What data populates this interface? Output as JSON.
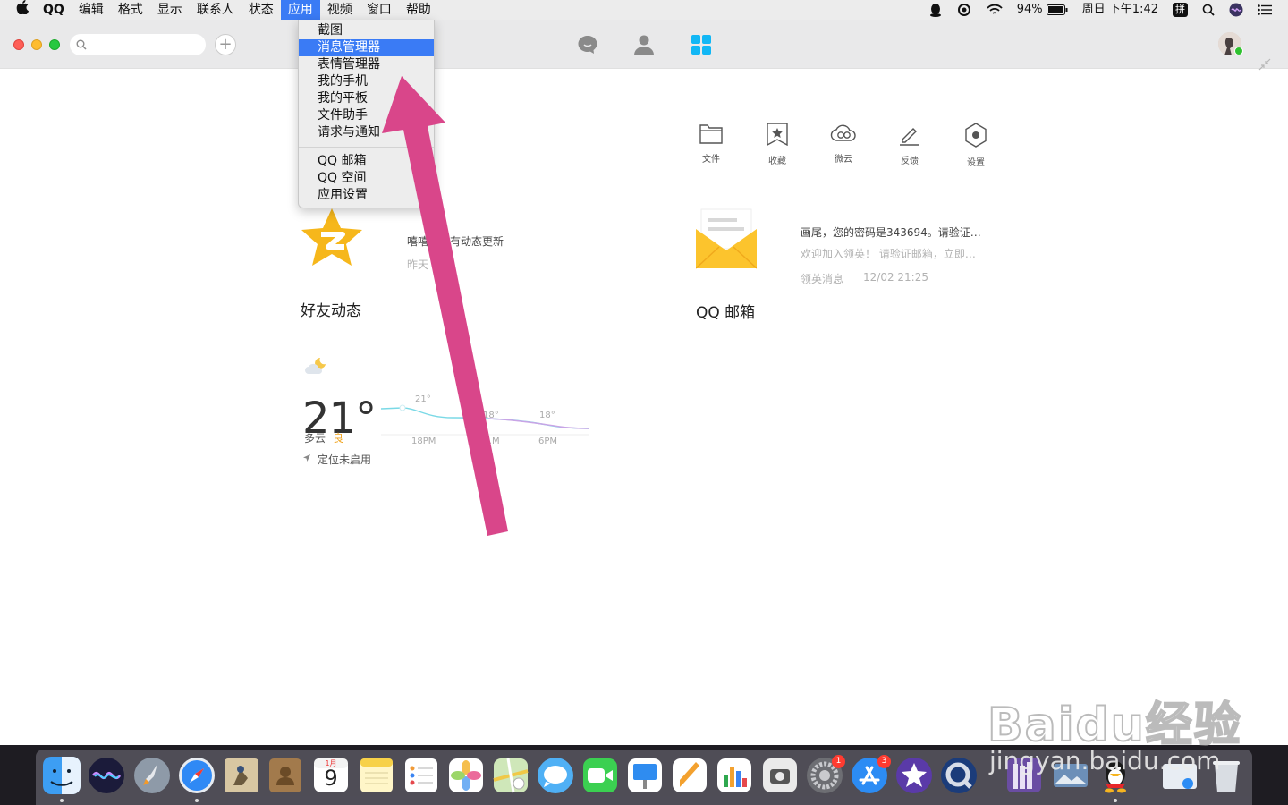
{
  "menubar": {
    "app_name": "QQ",
    "items": [
      "编辑",
      "格式",
      "显示",
      "联系人",
      "状态",
      "应用",
      "视频",
      "窗口",
      "帮助"
    ],
    "battery": "94%",
    "datetime": "周日 下午1:42",
    "input_method": "拼"
  },
  "app_menu": {
    "items_group1": [
      "截图",
      "消息管理器",
      "表情管理器",
      "我的手机",
      "我的平板",
      "文件助手",
      "请求与通知"
    ],
    "highlighted": "消息管理器",
    "items_group2": [
      "QQ 邮箱",
      "QQ 空间",
      "应用设置"
    ]
  },
  "quick_actions": [
    "文件",
    "收藏",
    "微云",
    "反馈",
    "设置"
  ],
  "qzone": {
    "title": "好友动态",
    "status": "嘻嘻…没有动态更新",
    "time": "昨天 …9"
  },
  "mail": {
    "title": "QQ 邮箱",
    "subject": "画尾，您的密码是343694。请验证…",
    "preview": "欢迎加入领英！ 请验证邮箱，立即…",
    "sender": "领英消息",
    "time": "12/02 21:25"
  },
  "weather": {
    "temperature": "21°",
    "condition": "多云",
    "air_quality": "良",
    "location": "定位未启用",
    "chart_labels": [
      "21°",
      "18°",
      "18°"
    ],
    "time_labels": [
      "18PM",
      "…M",
      "6PM"
    ]
  },
  "dock": {
    "calendar_month": "1月",
    "calendar_day": "9",
    "badges": {
      "system_preferences": "1",
      "app_store": "3"
    }
  },
  "watermark": {
    "line1": "Baidu经验",
    "line2": "jingyan.baidu.com"
  },
  "colors": {
    "accent": "#3a7bf5",
    "arrow": "#d9468a",
    "qq_blue": "#12b7f5"
  }
}
